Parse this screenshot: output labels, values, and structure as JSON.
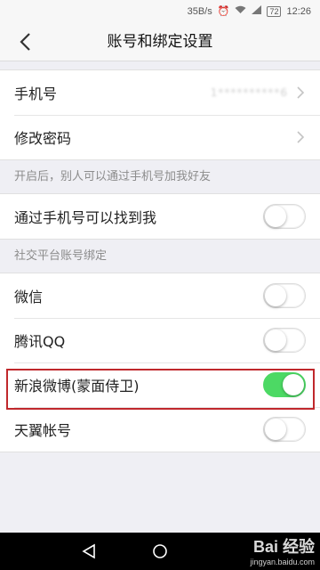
{
  "status_bar": {
    "network_speed": "35B/s",
    "battery": "72",
    "time": "12:26"
  },
  "header": {
    "title": "账号和绑定设置"
  },
  "account_group": [
    {
      "label": "手机号",
      "value": "1**********6"
    },
    {
      "label": "修改密码"
    }
  ],
  "sections": {
    "phone_hint": "开启后，别人可以通过手机号加我好友",
    "social_title": "社交平台账号绑定"
  },
  "find_by_phone": {
    "label": "通过手机号可以找到我",
    "enabled": false
  },
  "social_bindings": [
    {
      "label": "微信",
      "enabled": false
    },
    {
      "label": "腾讯QQ",
      "enabled": false
    },
    {
      "label": "新浪微博(蒙面侍卫)",
      "enabled": true
    },
    {
      "label": "天翼帐号",
      "enabled": false
    }
  ],
  "watermark": {
    "main": "Bai 经验",
    "sub": "jingyan.baidu.com"
  },
  "colors": {
    "toggle_on": "#4cd964",
    "highlight": "#c0282c"
  },
  "icons": {
    "back": "chevron-left-icon",
    "disclosure": "chevron-right-icon",
    "nav_back": "triangle-back-icon",
    "nav_home": "circle-home-icon"
  }
}
